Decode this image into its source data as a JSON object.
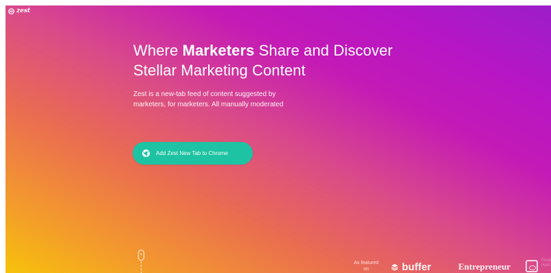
{
  "logo": {
    "text": "zest",
    "icon": "zest-logo-icon"
  },
  "hero": {
    "headline_before": "Where ",
    "headline_strong": "Marketers",
    "headline_after": " Share and Discover",
    "headline_line2": "Stellar Marketing Content",
    "subtext_line1": "Zest is a new-tab feed of content suggested by",
    "subtext_line2": "marketers, for marketers. All manually moderated",
    "cta_label": "Add Zest New Tab to Chrome",
    "cta_icon": "chrome-icon"
  },
  "featured": {
    "label": "As featured on",
    "buffer": "buffer",
    "entrepreneur": "Entrepreneur",
    "third_caption": "Product Hunt"
  },
  "colors": {
    "cta": "#1dc3a2",
    "gradient_start": "#f7c20a",
    "gradient_mid": "#d94a8a",
    "gradient_end": "#9c1ec9"
  }
}
